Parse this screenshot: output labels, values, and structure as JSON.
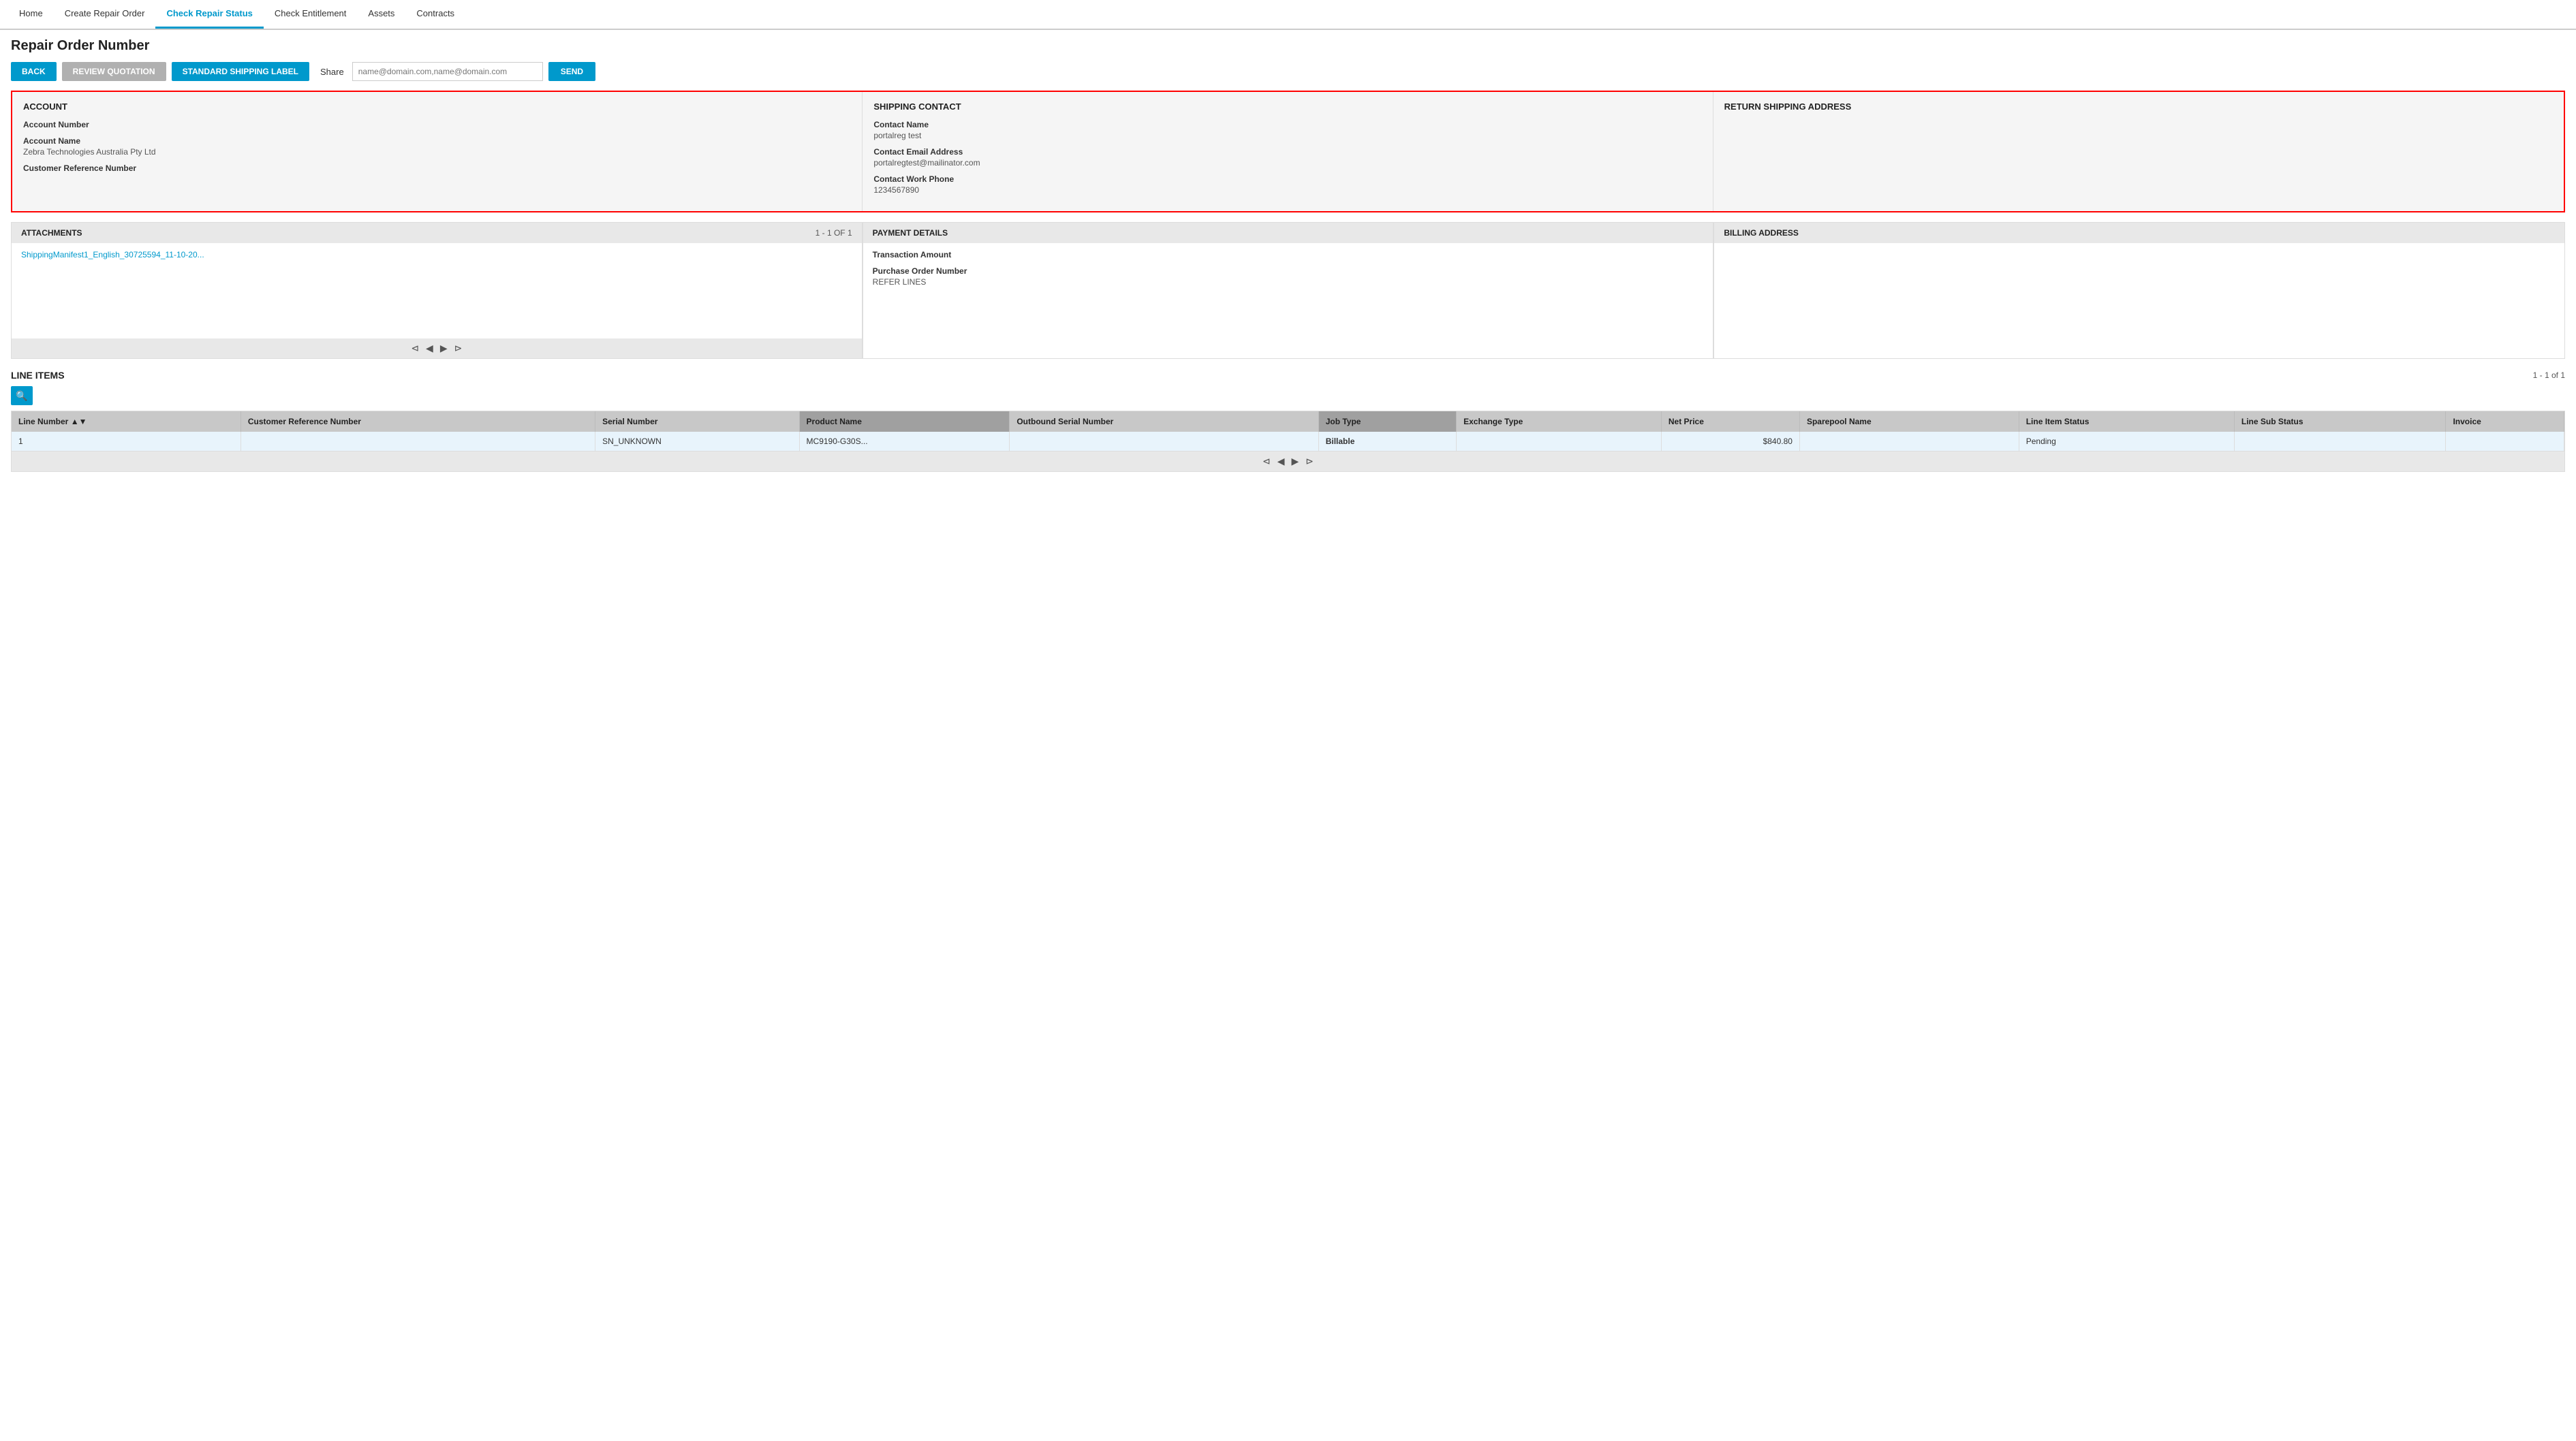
{
  "nav": {
    "items": [
      {
        "id": "home",
        "label": "Home",
        "active": false
      },
      {
        "id": "create-repair-order",
        "label": "Create Repair Order",
        "active": false
      },
      {
        "id": "check-repair-status",
        "label": "Check Repair Status",
        "active": true
      },
      {
        "id": "check-entitlement",
        "label": "Check Entitlement",
        "active": false
      },
      {
        "id": "assets",
        "label": "Assets",
        "active": false
      },
      {
        "id": "contracts",
        "label": "Contracts",
        "active": false
      }
    ]
  },
  "page": {
    "title": "Repair Order Number",
    "toolbar": {
      "back_label": "BACK",
      "review_label": "REVIEW QUOTATION",
      "shipping_label": "STANDARD SHIPPING LABEL",
      "share_label": "Share",
      "share_placeholder": "name@domain.com,name@domain.com",
      "send_label": "SEND"
    }
  },
  "account": {
    "section_title": "ACCOUNT",
    "fields": [
      {
        "label": "Account Number",
        "value": ""
      },
      {
        "label": "Account Name",
        "value": "Zebra Technologies Australia Pty Ltd"
      },
      {
        "label": "Customer Reference Number",
        "value": ""
      }
    ]
  },
  "shipping_contact": {
    "section_title": "SHIPPING CONTACT",
    "fields": [
      {
        "label": "Contact Name",
        "value": "portalreg test"
      },
      {
        "label": "Contact Email Address",
        "value": "portalregtest@mailinator.com"
      },
      {
        "label": "Contact Work Phone",
        "value": "1234567890"
      }
    ]
  },
  "return_shipping": {
    "section_title": "RETURN SHIPPING ADDRESS",
    "fields": []
  },
  "attachments": {
    "section_title": "ATTACHMENTS",
    "count": "1 - 1 of 1",
    "links": [
      {
        "label": "ShippingManifest1_English_30725594_11-10-20..."
      }
    ]
  },
  "payment_details": {
    "section_title": "PAYMENT DETAILS",
    "fields": [
      {
        "label": "Transaction Amount",
        "value": ""
      },
      {
        "label": "Purchase Order Number",
        "value": "REFER LINES"
      }
    ]
  },
  "billing_address": {
    "section_title": "BILLING ADDRESS",
    "fields": []
  },
  "line_items": {
    "section_title": "LINE ITEMS",
    "count": "1 - 1 of 1",
    "columns": [
      "Line Number",
      "Customer Reference Number",
      "Serial Number",
      "Product Name",
      "Outbound Serial Number",
      "Job Type",
      "Exchange Type",
      "Net Price",
      "Sparepool Name",
      "Line Item Status",
      "Line Sub Status",
      "Invoice"
    ],
    "rows": [
      {
        "line_number": "1",
        "customer_ref": "",
        "serial_number": "SN_UNKNOWN",
        "product_name": "MC9190-G30S...",
        "outbound_serial": "",
        "job_type": "Billable",
        "exchange_type": "",
        "net_price": "$840.80",
        "sparepool": "",
        "line_item_status": "Pending",
        "line_sub_status": "",
        "invoice": ""
      }
    ]
  },
  "icons": {
    "search": "🔍",
    "first_page": "⊲",
    "prev_page": "◀",
    "next_page": "▶",
    "last_page": "⊳",
    "sort_asc": "▲",
    "sort_desc": "▼"
  }
}
